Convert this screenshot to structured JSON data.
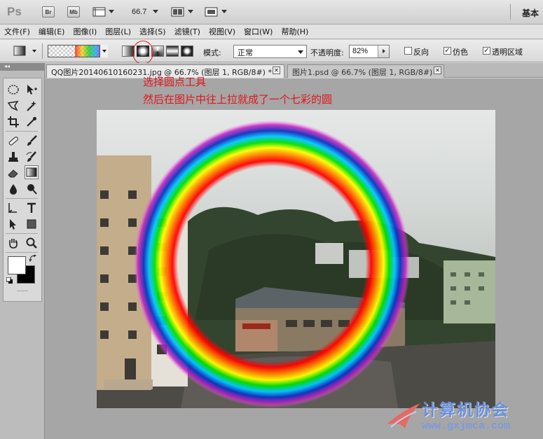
{
  "app": {
    "logo": "Ps",
    "bridge_label": "Br",
    "minibridge_label": "Mb",
    "zoom_level": "66.7",
    "workspace": "基本"
  },
  "menu": [
    "文件(F)",
    "编辑(E)",
    "图像(I)",
    "图层(L)",
    "选择(S)",
    "滤镜(T)",
    "视图(V)",
    "窗口(W)",
    "帮助(H)"
  ],
  "options": {
    "gradient_types": [
      "linear",
      "radial",
      "angle",
      "reflected",
      "diamond"
    ],
    "selected_gradient_type": "radial",
    "mode_label": "模式:",
    "mode_value": "正常",
    "opacity_label": "不透明度:",
    "opacity_value": "82%",
    "checkboxes": [
      {
        "label": "反向",
        "checked": false
      },
      {
        "label": "仿色",
        "checked": true
      },
      {
        "label": "透明区域",
        "checked": true
      }
    ]
  },
  "tabs": [
    {
      "title": "QQ图片20140610160231.jpg @ 66.7% (图层 1, RGB/8#) *",
      "active": true,
      "close": "✕"
    },
    {
      "title": "图片1.psd @ 66.7% (图层 1, RGB/8#)",
      "active": false,
      "close": "✕"
    }
  ],
  "annotation": {
    "line1": "选择圆点工具",
    "line2": "然后在图片中往上拉就成了一个七彩的圆",
    "color": "#e0141b"
  },
  "watermark": {
    "title": "计算机协会",
    "url": "www.gxjmca.com"
  },
  "colors": {
    "foreground": "#ffffff",
    "background": "#000000"
  },
  "tools": [
    "marquee-tool",
    "move-tool",
    "lasso-tool",
    "quick-select-tool",
    "crop-tool",
    "eyedropper-tool",
    "healing-brush-tool",
    "brush-tool",
    "clone-stamp-tool",
    "history-brush-tool",
    "eraser-tool",
    "gradient-tool",
    "blur-tool",
    "dodge-tool",
    "path-select-tool",
    "type-tool",
    "direct-select-tool",
    "shape-tool",
    "hand-tool",
    "zoom-tool"
  ]
}
